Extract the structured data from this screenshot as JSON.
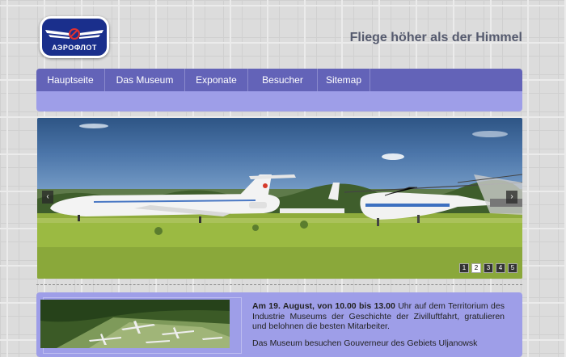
{
  "header": {
    "logo_text": "АЭРОФЛОТ",
    "slogan": "Fliege höher als der Himmel"
  },
  "nav": {
    "items": [
      "Hauptseite",
      "Das Museum",
      "Exponate",
      "Besucher",
      "Sitemap"
    ]
  },
  "slider": {
    "prev_label": "‹",
    "next_label": "›",
    "pages": [
      "1",
      "2",
      "3",
      "4",
      "5"
    ],
    "active_page": "2"
  },
  "content": {
    "para1_bold": "Am 19. August, von 10.00 bis 13.00",
    "para1_rest": " Uhr auf dem Territorium des Industrie Museums der Geschichte der Zivilluftfahrt, gratulieren und belohnen die besten Mitarbeiter.",
    "para2": "Das Museum besuchen Gouverneur des Gebiets Uljanowsk"
  }
}
